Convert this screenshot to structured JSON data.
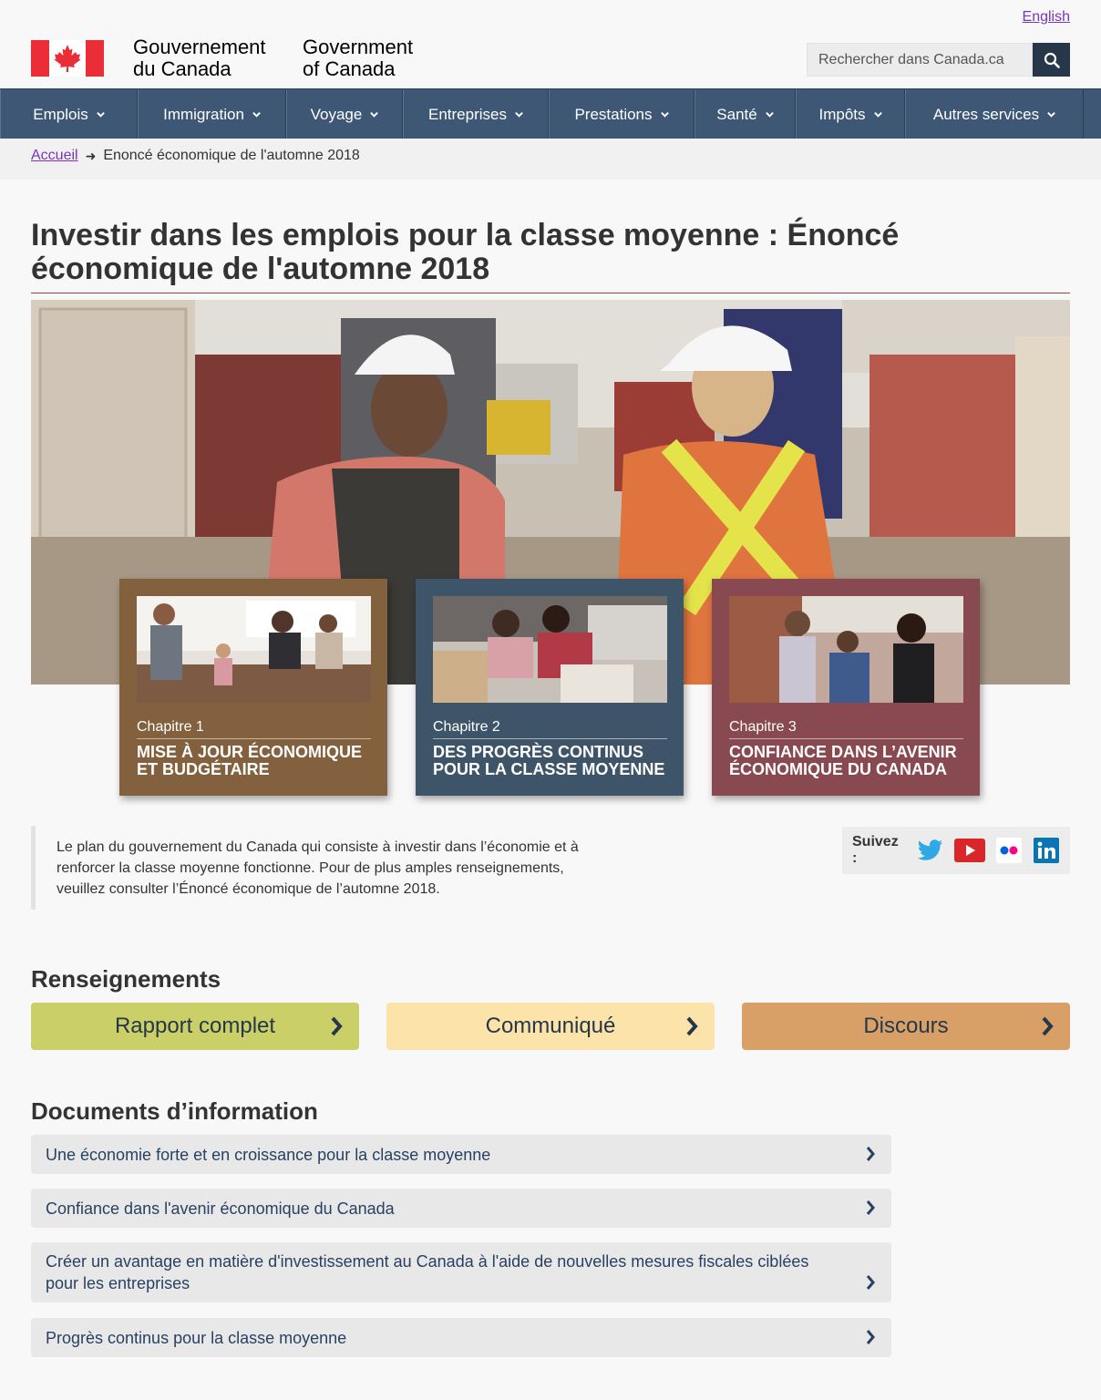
{
  "header": {
    "lang_link": "English",
    "wordmark_fr_line1": "Gouvernement",
    "wordmark_fr_line2": "du Canada",
    "wordmark_en_line1": "Government",
    "wordmark_en_line2": "of Canada",
    "search_placeholder": "Rechercher dans Canada.ca"
  },
  "menu": {
    "items": [
      "Emplois",
      "Immigration",
      "Voyage",
      "Entreprises",
      "Prestations",
      "Santé",
      "Impôts",
      "Autres services"
    ]
  },
  "breadcrumb": {
    "home": "Accueil",
    "current": "Enoncé économique de l'automne 2018"
  },
  "page": {
    "title": "Investir dans les emplois pour la classe moyenne : Énoncé économique de l'automne 2018"
  },
  "chapters": [
    {
      "label": "Chapitre 1",
      "title": "Mise à jour économique et budgétaire",
      "color": "#83613f"
    },
    {
      "label": "Chapitre 2",
      "title": "Des progrès continus pour la classe moyenne",
      "color": "#3e5468"
    },
    {
      "label": "Chapitre 3",
      "title": "Confiance dans l’avenir économique du Canada",
      "color": "#884951"
    }
  ],
  "intro": {
    "text": "Le plan du gouvernement du Canada qui consiste à investir dans l’économie et à renforcer la classe moyenne fonctionne. Pour de plus amples renseignements, veuillez consulter l’Énoncé économique de l’automne 2018."
  },
  "follow": {
    "label": "Suivez :",
    "icons": [
      "twitter-icon",
      "youtube-icon",
      "flickr-icon",
      "linkedin-icon"
    ]
  },
  "renseignements": {
    "heading": "Renseignements",
    "buttons": [
      {
        "label": "Rapport complet",
        "color": "#cbcf68"
      },
      {
        "label": "Communiqué",
        "color": "#fbe3a9"
      },
      {
        "label": "Discours",
        "color": "#d8a066"
      }
    ]
  },
  "documents": {
    "heading": "Documents d’information",
    "items": [
      "Une économie forte et en croissance pour la classe moyenne",
      "Confiance dans l'avenir économique du Canada",
      "Créer un avantage en matière d'investissement au Canada à l'aide de nouvelles mesures fiscales ciblées pour les entreprises",
      "Progrès continus pour la classe moyenne"
    ]
  }
}
